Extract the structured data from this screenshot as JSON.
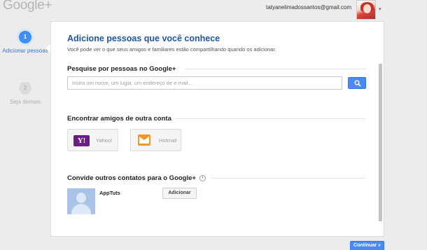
{
  "header": {
    "logo": "Google+",
    "email": "tatyanelimadossantos@gmail.com",
    "account_caret": "▾"
  },
  "steps": [
    {
      "number": "1",
      "label": "Adicionar pessoas",
      "active": true
    },
    {
      "number": "2",
      "label": "Seja demais",
      "active": false
    }
  ],
  "card": {
    "title": "Adicione pessoas que você conhece",
    "subtitle": "Você pode ver o que seus amigos e familiares estão compartilhando quando os adicionar."
  },
  "search_section": {
    "heading": "Pesquise por pessoas no Google+",
    "placeholder": "Insira um nome, um lugar, um endereço de e-mail...",
    "value": ""
  },
  "accounts_section": {
    "heading": "Encontrar amigos de outra conta",
    "providers": [
      {
        "label": "Yahoo!",
        "logo_text": "Y!"
      },
      {
        "label": "Hotmail"
      }
    ]
  },
  "invite_section": {
    "heading": "Convide outros contatos para o Google+",
    "info_glyph": "i",
    "contacts": [
      {
        "name": "AppTuts",
        "button_label": "Adicionar"
      }
    ]
  },
  "footer": {
    "continue_label": "Continuar »"
  },
  "colors": {
    "accent_blue": "#4a8af4",
    "title_blue": "#2156a5",
    "yahoo_purple": "#6b1c85",
    "hotmail_orange": "#f29626"
  }
}
